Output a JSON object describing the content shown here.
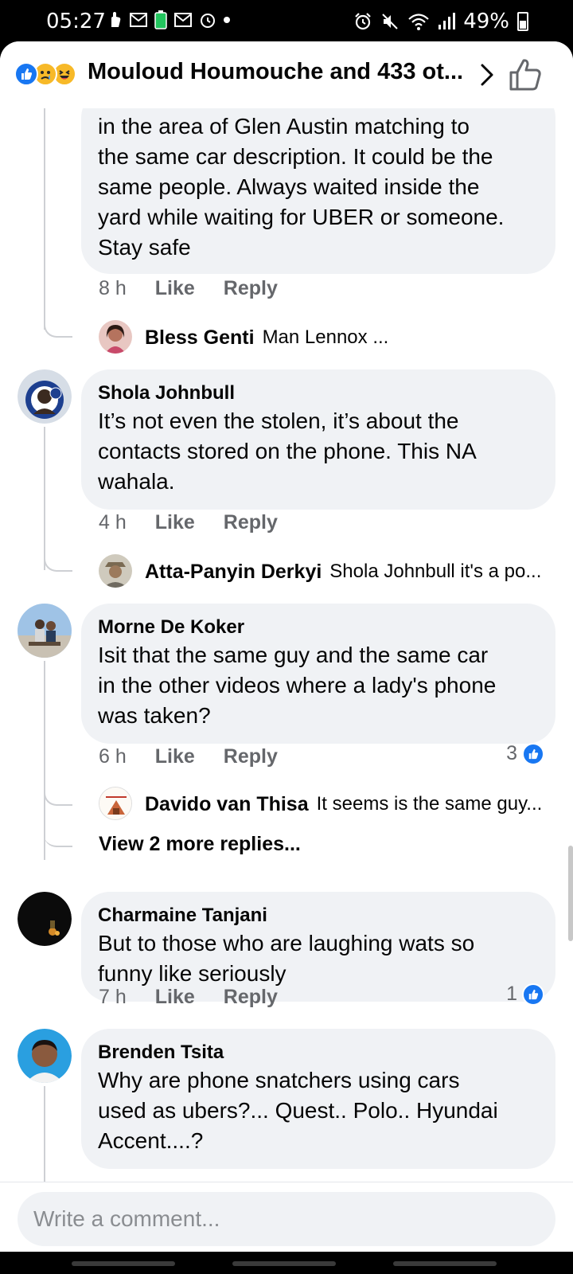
{
  "status_bar": {
    "time": "05:27",
    "battery_text": "49%",
    "battery_level": 0.49,
    "left_icons": [
      "hand-icon",
      "gmail-icon",
      "battery-saver-icon",
      "gmail-icon",
      "alarm-clock-icon",
      "dot-icon"
    ],
    "right_icons": [
      "alarm-icon",
      "mute-icon",
      "wifi-icon",
      "signal-icon"
    ]
  },
  "header": {
    "title": "Mouloud Houmouche and 433 ot...",
    "reaction_icons": [
      "like-reaction-icon",
      "sad-reaction-icon",
      "haha-reaction-icon"
    ]
  },
  "comments": [
    {
      "id": "c0",
      "author": "",
      "text_lines": [
        "in the area of Glen Austin matching to",
        "the same car description. It could be the",
        "same people. Always waited inside the",
        "yard while waiting for UBER or someone.",
        "Stay safe"
      ],
      "time": "8 h",
      "like": "Like",
      "reply": "Reply",
      "reply_preview": {
        "name": "Bless Genti",
        "text": "Man Lennox ..."
      }
    },
    {
      "id": "c1",
      "author": "Shola Johnbull",
      "text_lines": [
        "It’s not even the stolen, it’s about the",
        "contacts stored on the phone. This NA",
        "wahala."
      ],
      "time": "4 h",
      "like": "Like",
      "reply": "Reply",
      "reply_preview": {
        "name": "Atta-Panyin Derkyi",
        "text": "Shola Johnbull it's a po..."
      }
    },
    {
      "id": "c2",
      "author": "Morne De Koker",
      "text_lines": [
        "Isit that the same guy and the same car",
        "in the other videos where a lady's phone",
        "was taken?"
      ],
      "time": "6 h",
      "like": "Like",
      "reply": "Reply",
      "like_count": "3",
      "reply_preview": {
        "name": "Davido van Thisa",
        "text": "It seems is the same guy..."
      },
      "view_more": "View 2 more replies..."
    },
    {
      "id": "c3",
      "author": "Charmaine Tanjani",
      "text_lines": [
        "But to those who are laughing wats so",
        "funny like seriously"
      ],
      "time": "7 h",
      "like": "Like",
      "reply": "Reply",
      "like_count": "1"
    },
    {
      "id": "c4",
      "author": "Brenden Tsita",
      "text_lines": [
        "Why are phone snatchers using cars",
        "used as ubers?... Quest.. Polo.. Hyundai",
        "Accent....?"
      ]
    }
  ],
  "composer": {
    "placeholder": "Write a comment..."
  },
  "colors": {
    "facebook_blue": "#1877f2",
    "bubble_gray": "#f0f2f5",
    "secondary_text": "#65676b"
  }
}
